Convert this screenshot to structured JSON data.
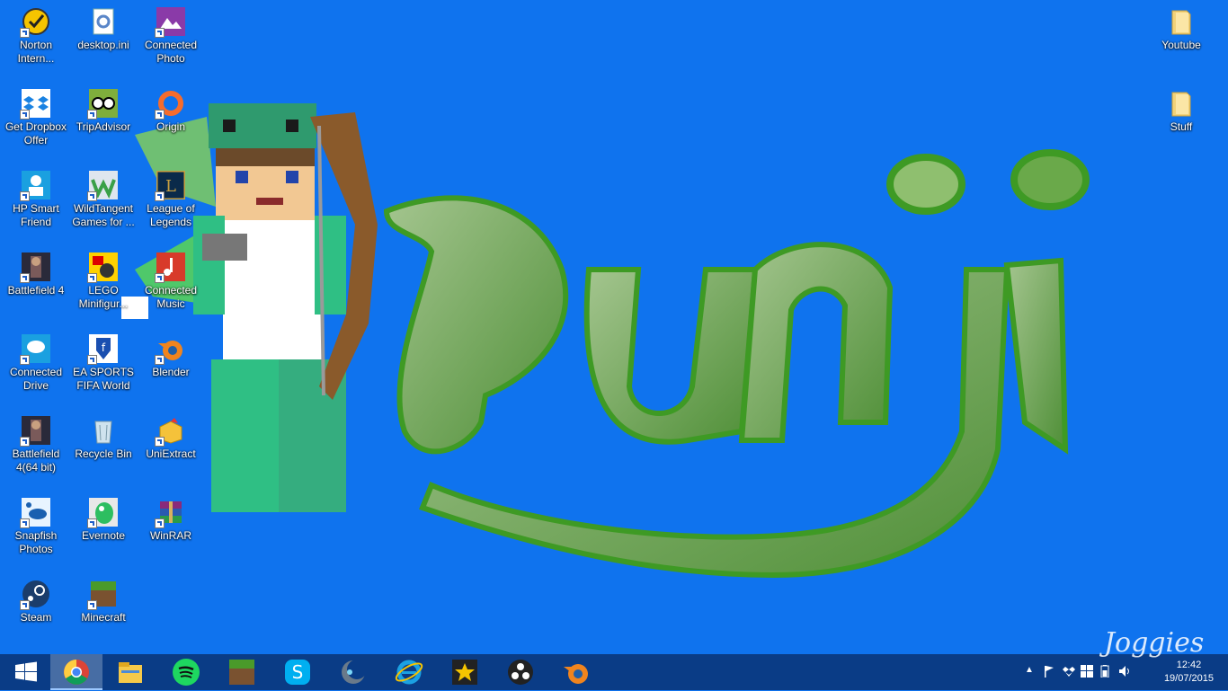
{
  "wallpaper": {
    "text": "Punji",
    "background": "#0f73ee",
    "letter_color": "#5cae3a"
  },
  "desktop_icons": [
    {
      "label": "Norton Intern...",
      "icon": "norton-icon"
    },
    {
      "label": "desktop.ini",
      "icon": "settings-file-icon"
    },
    {
      "label": "Connected Photo",
      "icon": "hp-photo-icon"
    },
    {
      "label": "Get Dropbox Offer",
      "icon": "dropbox-icon"
    },
    {
      "label": "TripAdvisor",
      "icon": "tripadvisor-icon"
    },
    {
      "label": "Origin",
      "icon": "origin-icon"
    },
    {
      "label": "HP Smart Friend",
      "icon": "hp-smart-friend-icon"
    },
    {
      "label": "WildTangent Games for ...",
      "icon": "wildtangent-icon"
    },
    {
      "label": "League of Legends",
      "icon": "league-of-legends-icon"
    },
    {
      "label": "Battlefield 4",
      "icon": "battlefield-icon"
    },
    {
      "label": "LEGO Minifigur...",
      "icon": "lego-icon"
    },
    {
      "label": "Connected Music",
      "icon": "hp-music-icon"
    },
    {
      "label": "Connected Drive",
      "icon": "hp-drive-icon"
    },
    {
      "label": "EA SPORTS FIFA World",
      "icon": "fifa-icon"
    },
    {
      "label": "Blender",
      "icon": "blender-icon"
    },
    {
      "label": "Battlefield 4(64 bit)",
      "icon": "battlefield-icon"
    },
    {
      "label": "Recycle Bin",
      "icon": "recycle-bin-icon"
    },
    {
      "label": "UniExtract",
      "icon": "box-icon"
    },
    {
      "label": "Snapfish Photos",
      "icon": "snapfish-icon"
    },
    {
      "label": "Evernote",
      "icon": "evernote-icon"
    },
    {
      "label": "WinRAR",
      "icon": "winrar-icon"
    },
    {
      "label": "Steam",
      "icon": "steam-icon"
    },
    {
      "label": "Minecraft",
      "icon": "minecraft-icon"
    },
    {
      "label": "Youtube",
      "icon": "folder-icon"
    },
    {
      "label": "Stuff",
      "icon": "folder-icon"
    }
  ],
  "taskbar": {
    "apps": [
      {
        "name": "start",
        "icon": "windows-start-icon"
      },
      {
        "name": "chrome",
        "icon": "chrome-icon",
        "active": true
      },
      {
        "name": "file-explorer",
        "icon": "file-explorer-icon"
      },
      {
        "name": "spotify",
        "icon": "spotify-icon"
      },
      {
        "name": "minecraft",
        "icon": "minecraft-icon"
      },
      {
        "name": "skype",
        "icon": "skype-icon"
      },
      {
        "name": "wildtangent",
        "icon": "moon-icon"
      },
      {
        "name": "internet-explorer",
        "icon": "internet-explorer-icon"
      },
      {
        "name": "movie-maker",
        "icon": "movie-maker-icon"
      },
      {
        "name": "obs",
        "icon": "obs-icon"
      },
      {
        "name": "blender",
        "icon": "blender-icon"
      }
    ],
    "tray": {
      "time": "12:42",
      "date": "19/07/2015"
    }
  },
  "watermark": "Joggies"
}
